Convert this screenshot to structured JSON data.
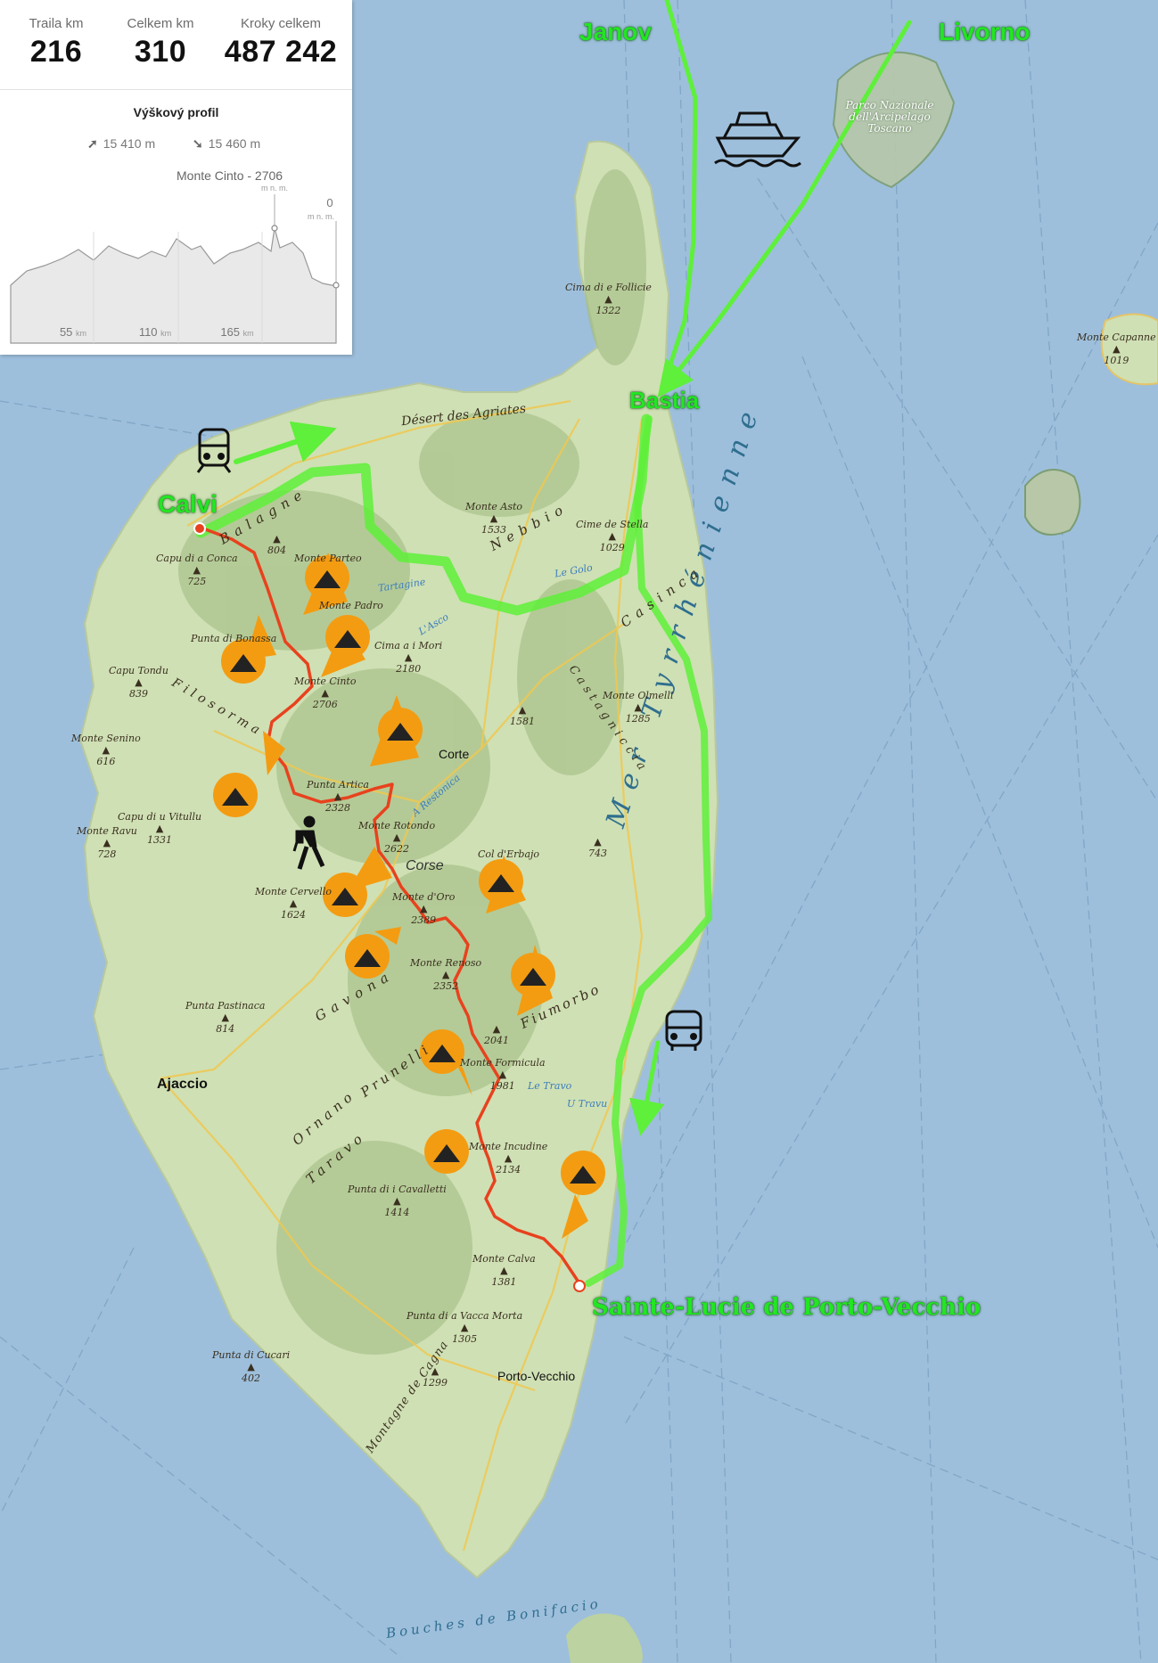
{
  "stats": [
    {
      "label": "Traila km",
      "value": "216"
    },
    {
      "label": "Celkem km",
      "value": "310"
    },
    {
      "label": "Kroky celkem",
      "value": "487 242"
    }
  ],
  "elevation": {
    "title": "Výškový profil",
    "ascent": "15 410 m",
    "descent": "15 460 m",
    "peak_label": "Monte Cinto - 2706",
    "axis_unit": "m n. m.",
    "end_value": "0",
    "km_ticks": [
      {
        "value": "55",
        "unit": "km"
      },
      {
        "value": "110",
        "unit": "km"
      },
      {
        "value": "165",
        "unit": "km"
      }
    ]
  },
  "highlight_labels": {
    "janov": "Janov",
    "livorno": "Livorno",
    "bastia": "Bastia",
    "calvi": "Calvi",
    "sainte_lucie": "Sainte-Lucie de Porto-Vecchio"
  },
  "towns": {
    "corte": "Corte",
    "ajaccio": "Ajaccio",
    "porto_vecchio": "Porto-Vecchio",
    "corse": "Corse"
  },
  "sea_labels": {
    "tyrrhenian": "Mer Tyrrhénienne",
    "bonifacio": "Bouches de Bonifacio"
  },
  "park_label": "Parco Nazionale dell'Arcipelago Toscano",
  "regions": {
    "agriates": "Désert des Agriates",
    "balagne": "Balagne",
    "nebbio": "Nebbio",
    "casinca": "Casinca",
    "castagniccia": "Castagniccia",
    "filosorma": "Filosorma",
    "gavona": "Gavona",
    "fiumorbo": "Fiumorbo",
    "prunelli": "Prunelli",
    "ornano": "Ornano",
    "taravo": "Taravo",
    "cagna": "Montagne de Cagna"
  },
  "peaks": {
    "follicie": {
      "name": "Cima di e Follicie",
      "elev": "1322"
    },
    "capanne": {
      "name": "Monte Capanne",
      "elev": "1019"
    },
    "asto": {
      "name": "Monte Asto",
      "elev": "1533"
    },
    "stella": {
      "name": "Cime de Stella",
      "elev": "1029"
    },
    "conca": {
      "name": "Capu di a Conca",
      "elev": "725"
    },
    "e804": {
      "name": "",
      "elev": "804"
    },
    "parteo": {
      "name": "Monte Parteo",
      "elev": ""
    },
    "padro": {
      "name": "Monte Padro",
      "elev": ""
    },
    "mori": {
      "name": "Cima a i Mori",
      "elev": "2180"
    },
    "bonassa": {
      "name": "Punta di Bonassa",
      "elev": ""
    },
    "tondu": {
      "name": "Capu Tondu",
      "elev": "839"
    },
    "cinto": {
      "name": "Monte Cinto",
      "elev": "2706"
    },
    "olmelli": {
      "name": "Monte Olmelli",
      "elev": "1285"
    },
    "e1581": {
      "name": "",
      "elev": "1581"
    },
    "senino": {
      "name": "Monte Senino",
      "elev": "616"
    },
    "artica": {
      "name": "Punta Artica",
      "elev": "2328"
    },
    "vitullu": {
      "name": "Capu di u Vitullu",
      "elev": "1331"
    },
    "ravu": {
      "name": "Monte Ravu",
      "elev": "728"
    },
    "rotondo": {
      "name": "Monte Rotondo",
      "elev": "2622"
    },
    "e743": {
      "name": "",
      "elev": "743"
    },
    "erbajo": {
      "name": "Col d'Erbajo",
      "elev": ""
    },
    "cervello": {
      "name": "Monte Cervello",
      "elev": "1624"
    },
    "oro": {
      "name": "Monte d'Oro",
      "elev": "2389"
    },
    "renoso": {
      "name": "Monte Renoso",
      "elev": "2352"
    },
    "e2041": {
      "name": "",
      "elev": "2041"
    },
    "pastinaca": {
      "name": "Punta Pastinaca",
      "elev": "814"
    },
    "formicula": {
      "name": "Monte Formicula",
      "elev": "1981"
    },
    "incudine": {
      "name": "Monte Incudine",
      "elev": "2134"
    },
    "cavalletti": {
      "name": "Punta di i Cavalletti",
      "elev": "1414"
    },
    "calva": {
      "name": "Monte Calva",
      "elev": "1381"
    },
    "vacca": {
      "name": "Punta di a Vacca Morta",
      "elev": "1305"
    },
    "cucari": {
      "name": "Punta di Cucari",
      "elev": "402"
    },
    "e1299": {
      "name": "",
      "elev": "1299"
    }
  },
  "rivers": {
    "golo": "Le Golo",
    "tartagine": "Tartagine",
    "asco": "L'Asco",
    "travo": "Le Travo",
    "u_travu": "U Travu",
    "restonica": "A Restonica"
  },
  "icon_names": [
    "ferry-icon",
    "train-icon",
    "bus-icon",
    "hiker-icon",
    "tent-day-icon",
    "tent-night-icon"
  ],
  "colors": {
    "sea": "#9dbfdc",
    "land": "#cfe0b4",
    "transfer_route": "#5ef03a",
    "trail": "#e8421e",
    "campsite_marker": "#f39c12",
    "highlight_text": "#22e622"
  }
}
